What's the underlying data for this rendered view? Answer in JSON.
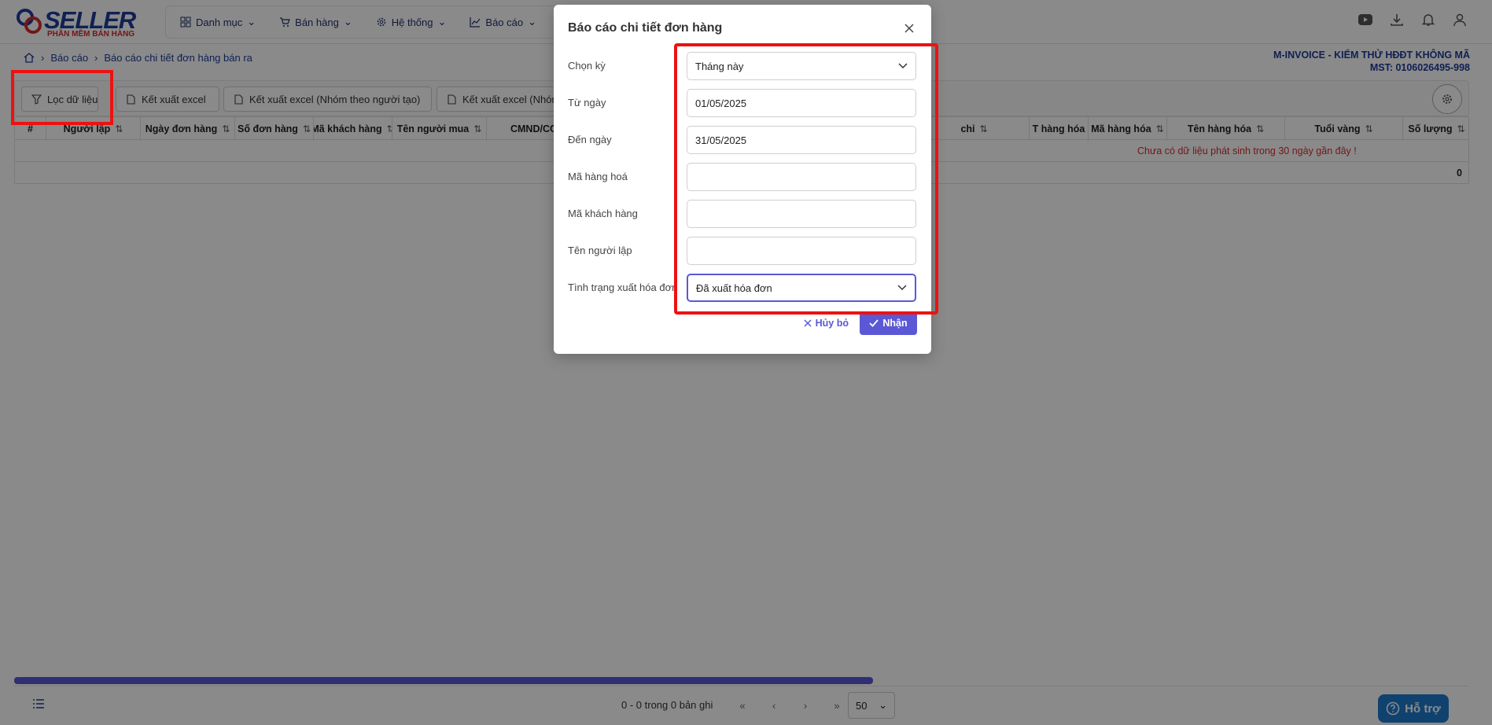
{
  "brand": {
    "name": "SELLER",
    "tagline": "PHẦN MỀM BÁN HÀNG"
  },
  "nav": [
    {
      "label": "Danh mục",
      "icon": "grid-icon"
    },
    {
      "label": "Bán hàng",
      "icon": "cart-icon"
    },
    {
      "label": "Hệ thống",
      "icon": "gear-icon"
    },
    {
      "label": "Báo cáo",
      "icon": "chart-icon"
    }
  ],
  "top_icons": [
    "youtube-icon",
    "download-icon",
    "bell-icon",
    "user-icon"
  ],
  "breadcrumb": {
    "level1": "Báo cáo",
    "level2": "Báo cáo chi tiết đơn hàng bán ra"
  },
  "company": {
    "name": "M-INVOICE - KIỂM THỬ HĐĐT KHÔNG MÃ",
    "tax_code": "MST: 0106026495-998"
  },
  "toolbar": {
    "filter": "Lọc dữ liệu",
    "export_excel": "Kết xuất excel",
    "export_by_creator": "Kết xuất excel (Nhóm theo người tạo)",
    "export_group": "Kết xuất excel (Nhóm"
  },
  "table": {
    "columns": [
      "#",
      "Người lập",
      "Ngày đơn hàng",
      "Số đơn hàng",
      "Mã khách hàng",
      "Tên người mua",
      "CMND/CC",
      "chỉ",
      "T hàng hóa",
      "Mã hàng hóa",
      "Tên hàng hóa",
      "Tuổi vàng",
      "Số lượng"
    ],
    "empty_message": "Chưa có dữ liệu phát sinh trong 30 ngày gần đây !",
    "total": "0"
  },
  "pager": {
    "info": "0 - 0 trong 0 bản ghi",
    "first": "«",
    "prev": "‹",
    "next": "›",
    "last": "»",
    "page_size": "50"
  },
  "help": {
    "label": "Hỗ trợ"
  },
  "modal": {
    "title": "Báo cáo chi tiết đơn hàng",
    "fields": {
      "period": {
        "label": "Chọn kỳ",
        "value": "Tháng này"
      },
      "from_date": {
        "label": "Từ ngày",
        "value": "01/05/2025"
      },
      "to_date": {
        "label": "Đến ngày",
        "value": "31/05/2025"
      },
      "product_code": {
        "label": "Mã hàng hoá",
        "value": ""
      },
      "customer_code": {
        "label": "Mã khách hàng",
        "value": ""
      },
      "creator_name": {
        "label": "Tên người lập",
        "value": ""
      },
      "invoice_status": {
        "label": "Tình trạng xuất hóa đơn",
        "value": "Đã xuất hóa đơn"
      }
    },
    "cancel": "Hủy bỏ",
    "submit": "Nhận"
  },
  "colors": {
    "primary": "#5b58d6",
    "brand_blue": "#1f3c99",
    "highlight": "#e11111",
    "error_text": "#d92c2c"
  }
}
